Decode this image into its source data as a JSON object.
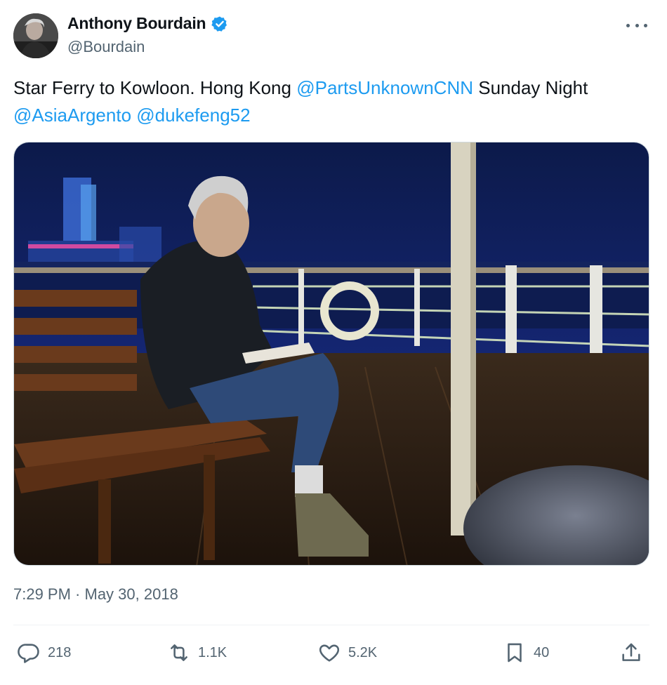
{
  "author": {
    "display_name": "Anthony Bourdain",
    "handle": "@Bourdain",
    "verified_icon": "verified-badge-icon",
    "avatar_icon": "avatar"
  },
  "tweet": {
    "text_intro": "Star Ferry to Kowloon. Hong Kong ",
    "mention_1": "@PartsUnknownCNN",
    "text_mid": " Sunday Night",
    "mention_2": "@AsiaArgento",
    "mention_3": "@dukefeng52",
    "time": "7:29 PM",
    "separator": " · ",
    "date": "May 30, 2018"
  },
  "metrics": {
    "replies": "218",
    "retweets": "1.1K",
    "likes": "5.2K",
    "bookmarks": "40"
  },
  "icons": {
    "more": "more-icon",
    "reply": "reply-icon",
    "retweet": "retweet-icon",
    "like": "heart-icon",
    "bookmark": "bookmark-icon",
    "share": "share-icon"
  },
  "colors": {
    "accent": "#1d9bf0",
    "text": "#0f1419",
    "secondary": "#536471"
  }
}
